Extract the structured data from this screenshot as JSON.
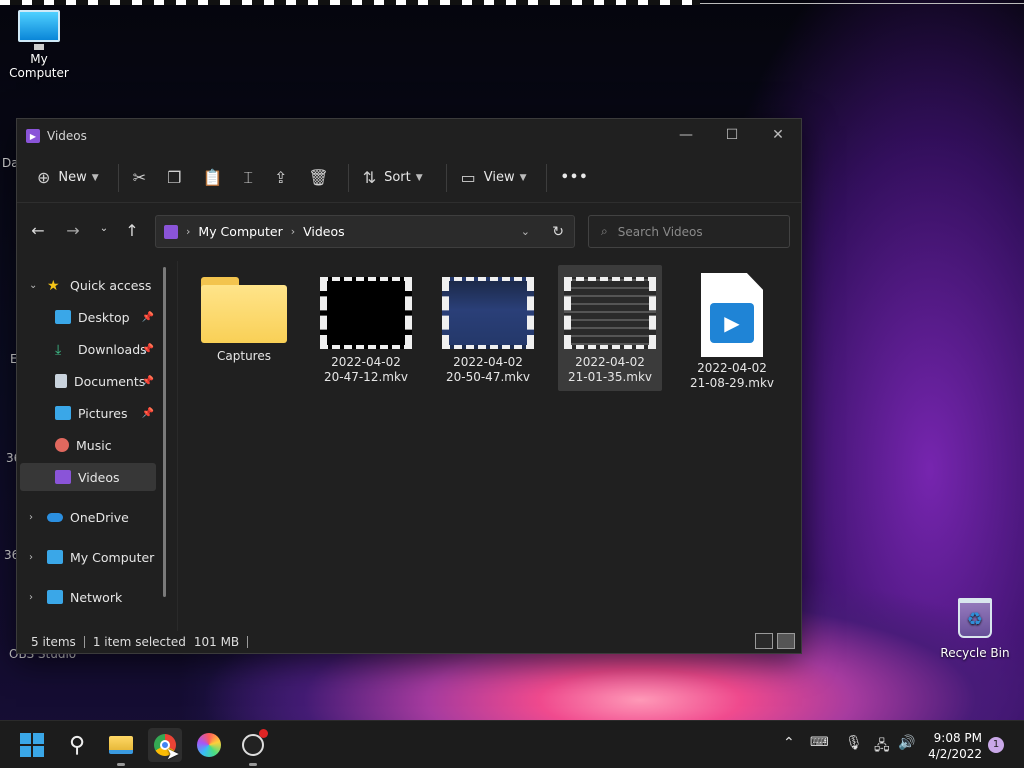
{
  "desktop": {
    "icons": [
      {
        "label": "My Computer"
      },
      {
        "label": "Recycle Bin"
      },
      {
        "label": "OBS Studio"
      }
    ],
    "partial_labels": [
      "Da",
      "E",
      "36",
      "36"
    ]
  },
  "window": {
    "title": "Videos",
    "controls": {
      "minimize": "—",
      "maximize": "☐",
      "close": "✕"
    },
    "toolbar": {
      "new_label": "New",
      "sort_label": "Sort",
      "view_label": "View",
      "more_label": "•••"
    },
    "address": {
      "crumbs": [
        "My Computer",
        "Videos"
      ]
    },
    "search": {
      "placeholder": "Search Videos"
    },
    "sidebar": {
      "items": [
        {
          "label": "Quick access",
          "icon": "star-icon"
        },
        {
          "label": "Desktop",
          "icon": "desktop-icon",
          "pinned": true
        },
        {
          "label": "Downloads",
          "icon": "download-icon",
          "pinned": true
        },
        {
          "label": "Documents",
          "icon": "document-icon",
          "pinned": true
        },
        {
          "label": "Pictures",
          "icon": "picture-icon",
          "pinned": true
        },
        {
          "label": "Music",
          "icon": "music-icon"
        },
        {
          "label": "Videos",
          "icon": "video-icon",
          "selected": true
        },
        {
          "label": "OneDrive",
          "icon": "cloud-icon"
        },
        {
          "label": "My Computer",
          "icon": "computer-icon"
        },
        {
          "label": "Network",
          "icon": "network-icon"
        }
      ]
    },
    "files": [
      {
        "line1": "Captures",
        "line2": "",
        "type": "folder"
      },
      {
        "line1": "2022-04-02",
        "line2": "20-47-12.mkv",
        "type": "video-black"
      },
      {
        "line1": "2022-04-02",
        "line2": "20-50-47.mkv",
        "type": "video-obs"
      },
      {
        "line1": "2022-04-02",
        "line2": "21-01-35.mkv",
        "type": "video-ui",
        "selected": true
      },
      {
        "line1": "2022-04-02",
        "line2": "21-08-29.mkv",
        "type": "video-doc"
      }
    ],
    "status": {
      "items_count": "5 items",
      "selected": "1 item selected",
      "size": "101 MB"
    }
  },
  "taskbar": {
    "clock_time": "9:08 PM",
    "clock_date": "4/2/2022",
    "notification_count": "1"
  },
  "colors": {
    "accent": "#8a54d8",
    "folder": "#f9d056",
    "window_bg": "#202020",
    "taskbar_bg": "#1c1c1c"
  }
}
